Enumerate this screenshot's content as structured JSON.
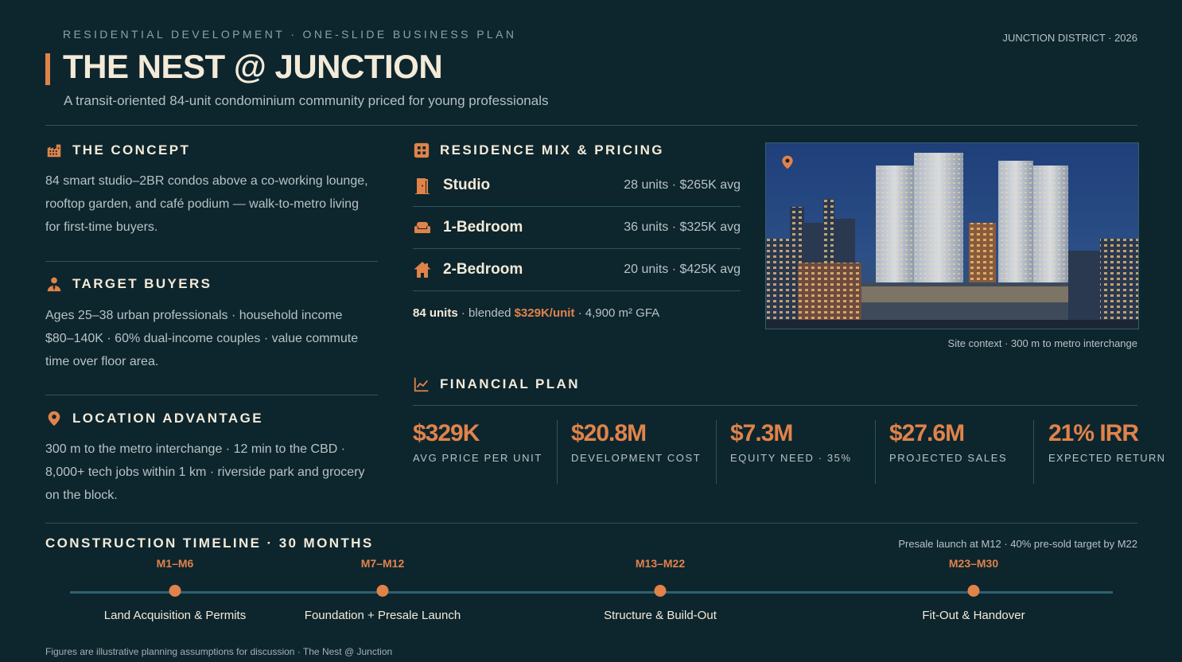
{
  "header": {
    "eyebrow": "RESIDENTIAL DEVELOPMENT  ·  ONE-SLIDE BUSINESS PLAN",
    "district": "JUNCTION DISTRICT · 2026",
    "title": "THE NEST @ JUNCTION",
    "subtitle": "A transit-oriented 84-unit condominium community priced for young professionals"
  },
  "concept": {
    "heading": "THE CONCEPT",
    "icon": "building-icon",
    "text": "84 smart studio–2BR condos above a co-working lounge, rooftop garden, and café podium — walk-to-metro living for first-time buyers."
  },
  "buyers": {
    "heading": "TARGET BUYERS",
    "icon": "professional-icon",
    "text": "Ages 25–38 urban professionals · household income $80–140K · 60% dual-income couples · value commute time over floor area."
  },
  "location": {
    "heading": "LOCATION ADVANTAGE",
    "icon": "map-pin-icon",
    "text": "300 m to the metro interchange · 12 min to the CBD · 8,000+ tech jobs within 1 km · riverside park and grocery on the block."
  },
  "mix": {
    "heading": "RESIDENCE MIX & PRICING",
    "icon": "grid-icon",
    "rows": [
      {
        "name": "Studio",
        "meta": "28 units · $265K avg",
        "icon": "door-icon"
      },
      {
        "name": "1-Bedroom",
        "meta": "36 units · $325K avg",
        "icon": "sofa-icon"
      },
      {
        "name": "2-Bedroom",
        "meta": "20 units · $425K avg",
        "icon": "house-icon"
      }
    ],
    "summary": {
      "units": "84 units",
      "blended_label": "· blended",
      "blended_value": "$329K/unit",
      "gfa": "· 4,900 m² GFA"
    }
  },
  "photo": {
    "caption": "Site context · 300 m to metro interchange",
    "icon": "map-pin-icon"
  },
  "financial": {
    "heading": "FINANCIAL PLAN",
    "icon": "trend-chart-icon",
    "kpis": [
      {
        "value": "$329K",
        "label": "AVG PRICE PER UNIT"
      },
      {
        "value": "$20.8M",
        "label": "DEVELOPMENT COST"
      },
      {
        "value": "$7.3M",
        "label": "EQUITY NEED · 35%"
      },
      {
        "value": "$27.6M",
        "label": "PROJECTED SALES"
      },
      {
        "value": "21% IRR",
        "label": "EXPECTED RETURN"
      }
    ]
  },
  "timeline": {
    "heading": "CONSTRUCTION TIMELINE · 30 MONTHS",
    "note": "Presale launch at M12 · 40% pre-sold target by M22",
    "milestones": [
      {
        "code": "M1–M6",
        "label": "Land Acquisition & Permits"
      },
      {
        "code": "M7–M12",
        "label": "Foundation + Presale Launch"
      },
      {
        "code": "M13–M22",
        "label": "Structure & Build-Out"
      },
      {
        "code": "M23–M30",
        "label": "Fit-Out & Handover"
      }
    ]
  },
  "footnote": "Figures are illustrative planning assumptions for discussion · The Nest @ Junction",
  "colors": {
    "background": "#0d252d",
    "accent": "#e0834a",
    "heading": "#f3ead8",
    "body_text": "#b7c3c6",
    "rule": "#2b5463"
  }
}
